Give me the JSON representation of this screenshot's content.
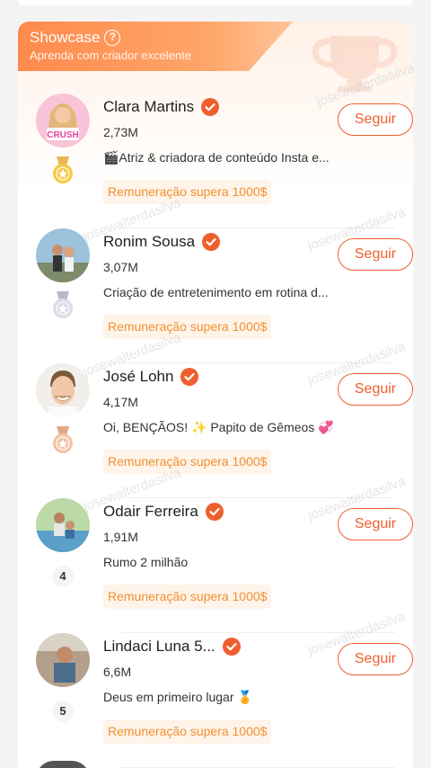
{
  "banner": {
    "title": "Showcase",
    "subtitle": "Aprenda com criador excelente",
    "help_icon": "help-circle-icon"
  },
  "watermark": "josewalterdasilva",
  "creators": [
    {
      "rank": 1,
      "rank_style": "gold-medal",
      "name": "Clara Martins",
      "followers": "2,73M",
      "bio": "🎬Atriz & criadora de conteúdo Insta e...",
      "tag": "Remuneração supera 1000$",
      "follow_label": "Seguir",
      "avatar_caption": "CRUSH"
    },
    {
      "rank": 2,
      "rank_style": "silver-medal",
      "name": "Ronim Sousa",
      "followers": "3,07M",
      "bio": "Criação de entretenimento em rotina d...",
      "tag": "Remuneração supera 1000$",
      "follow_label": "Seguir"
    },
    {
      "rank": 3,
      "rank_style": "bronze-medal",
      "name": "José Lohn",
      "followers": "4,17M",
      "bio": "Oi, BENÇÃOS! ✨ Papito de Gêmeos 💞",
      "tag": "Remuneração supera 1000$",
      "follow_label": "Seguir"
    },
    {
      "rank": 4,
      "rank_style": "number",
      "name": "Odair Ferreira",
      "followers": "1,91M",
      "bio": "Rumo 2 milhão",
      "tag": "Remuneração supera 1000$",
      "follow_label": "Seguir"
    },
    {
      "rank": 5,
      "rank_style": "number",
      "name": "Lindaci Luna 5...",
      "followers": "6,6M",
      "bio": "Deus em primeiro lugar 🏅",
      "tag": "Remuneração supera 1000$",
      "follow_label": "Seguir"
    }
  ],
  "colors": {
    "accent": "#ee5f2e",
    "tag_text": "#f0912f",
    "tag_bg": "#fff4ea",
    "banner": "#ff8a4c"
  }
}
